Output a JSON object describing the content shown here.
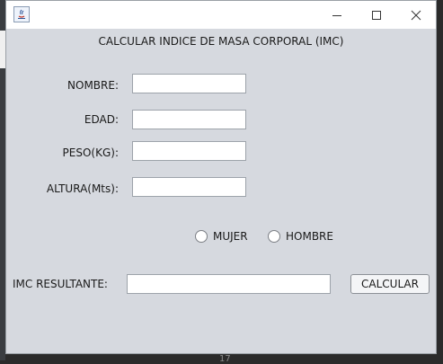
{
  "window": {
    "title": "",
    "heading": "CALCULAR INDICE DE MASA CORPORAL (IMC)"
  },
  "form": {
    "nombre_label": "NOMBRE:",
    "nombre_value": "",
    "edad_label": "EDAD:",
    "edad_value": "",
    "peso_label": "PESO(KG):",
    "peso_value": "",
    "altura_label": "ALTURA(Mts):",
    "altura_value": "",
    "sex_options": [
      "MUJER",
      "HOMBRE"
    ],
    "imc_label": "IMC RESULTANTE:",
    "imc_value": "",
    "calcular_label": "CALCULAR"
  },
  "background": {
    "line_number": "17"
  },
  "colors": {
    "window_bg": "#d6d9df",
    "titlebar_bg": "#ffffff",
    "ide_bg": "#2b2b2b"
  }
}
